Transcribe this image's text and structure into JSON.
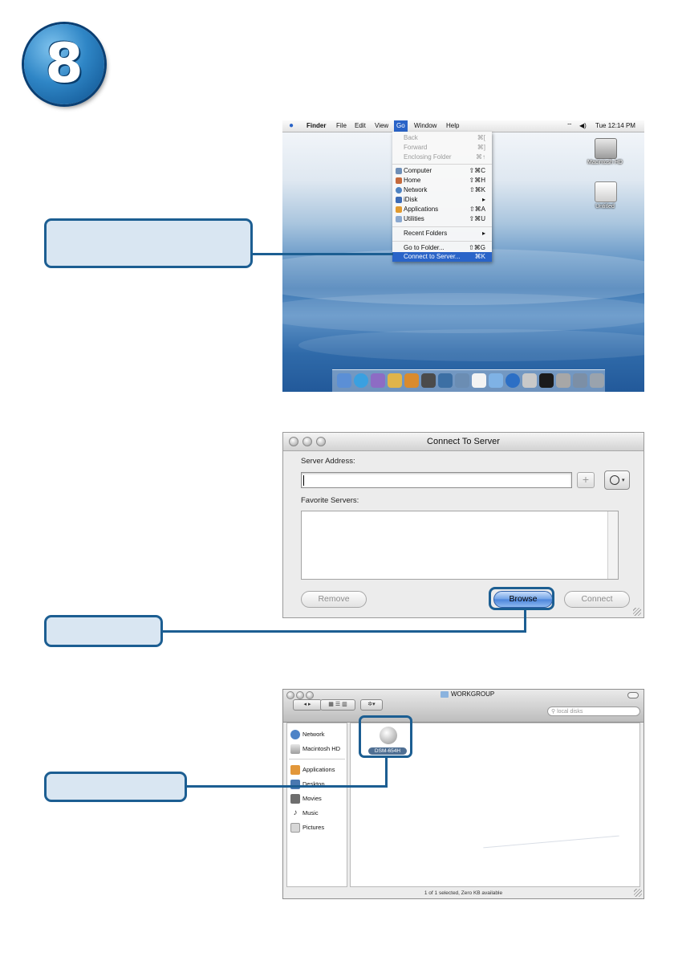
{
  "step": {
    "number": "8"
  },
  "callouts": {
    "one": "",
    "two": "",
    "three": ""
  },
  "shot1": {
    "menubar": {
      "apple": "",
      "items": [
        "Finder",
        "File",
        "Edit",
        "View",
        "Go",
        "Window",
        "Help"
      ],
      "clock": "Tue 12:14 PM"
    },
    "go_menu": [
      {
        "label": "Back",
        "key": "⌘[",
        "disabled": true
      },
      {
        "label": "Forward",
        "key": "⌘]",
        "disabled": true
      },
      {
        "label": "Enclosing Folder",
        "key": "⌘↑",
        "disabled": true
      },
      {
        "label": "Computer",
        "key": "⇧⌘C",
        "icon": "computer-icon"
      },
      {
        "label": "Home",
        "key": "⇧⌘H",
        "icon": "home-icon"
      },
      {
        "label": "Network",
        "key": "⇧⌘K",
        "icon": "network-icon"
      },
      {
        "label": "iDisk",
        "key": "▸",
        "icon": "idisk-icon"
      },
      {
        "label": "Applications",
        "key": "⇧⌘A",
        "icon": "applications-icon"
      },
      {
        "label": "Utilities",
        "key": "⇧⌘U",
        "icon": "utilities-icon"
      },
      {
        "label": "Recent Folders",
        "key": "▸"
      },
      {
        "label": "Go to Folder...",
        "key": "⇧⌘G"
      },
      {
        "label": "Connect to Server...",
        "key": "⌘K",
        "selected": true
      }
    ],
    "desktop_icons": [
      "Macintosh HD",
      "Untitled"
    ]
  },
  "shot2": {
    "window_title": "Connect To Server",
    "server_address_label": "Server Address:",
    "server_address_value": "",
    "favorites_label": "Favorite Servers:",
    "buttons": {
      "remove": "Remove",
      "browse": "Browse",
      "connect": "Connect"
    },
    "plus": "+"
  },
  "shot3": {
    "window_title": "WORKGROUP",
    "search_placeholder": "local disks",
    "sidebar": [
      "Network",
      "Macintosh HD",
      "Applications",
      "Desktop",
      "Movies",
      "Music",
      "Pictures"
    ],
    "item": "DSM-654H",
    "status": "1 of 1 selected, Zero KB available"
  },
  "colors": {
    "callout_fill": "#d9e6f2",
    "callout_border": "#1c5e92",
    "highlight": "#2a64c8"
  }
}
